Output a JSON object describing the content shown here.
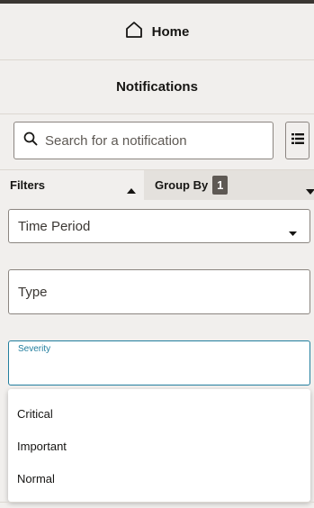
{
  "nav": {
    "home_label": "Home"
  },
  "page": {
    "title": "Notifications"
  },
  "search": {
    "placeholder": "Search for a notification",
    "value": ""
  },
  "filters": {
    "label": "Filters",
    "group_by_label": "Group By",
    "group_by_count": "1"
  },
  "fields": {
    "time_period": "Time Period",
    "type": "Type",
    "severity": "Severity"
  },
  "severity_options": [
    "Critical",
    "Important",
    "Normal"
  ],
  "icons": {
    "home": "home-icon",
    "search": "search-icon",
    "list": "list-view-icon",
    "collapse": "triangle-up-icon",
    "expand": "triangle-down-icon",
    "caret": "caret-down-icon"
  },
  "colors": {
    "accent": "#227e9e",
    "badge": "#5e5954",
    "background": "#f1efed"
  }
}
